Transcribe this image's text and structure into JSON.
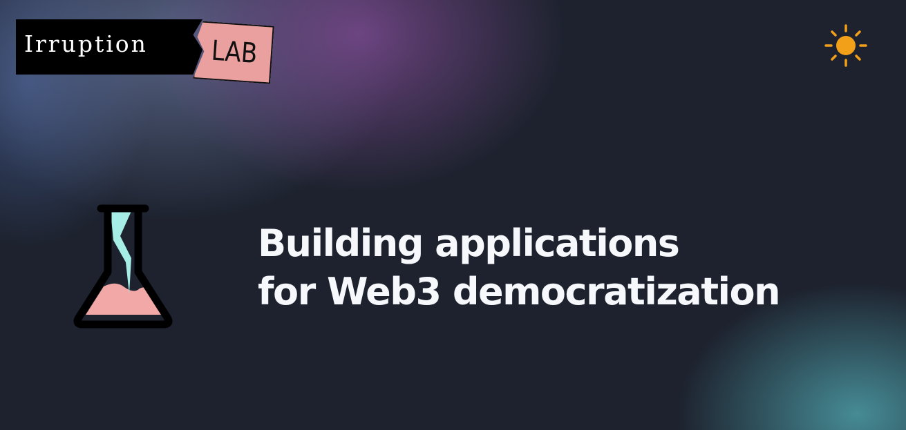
{
  "header": {
    "logo": {
      "wordmark": "Irruption",
      "badge": "LAB",
      "badge_color": "#e9a09e",
      "wordmark_background": "#000000"
    },
    "theme_toggle": {
      "icon": "sun-icon",
      "color": "#f29f19"
    }
  },
  "hero": {
    "illustration": "flask-icon",
    "headline_line1": "Building applications",
    "headline_line2": "for Web3 democratization",
    "liquid_color": "#f2a8a6",
    "lightning_color": "#a6ede6"
  },
  "colors": {
    "background": "#1d222e",
    "text": "#f6f8fb",
    "purple_glow": "#78488c",
    "teal_glow": "#48919b"
  }
}
